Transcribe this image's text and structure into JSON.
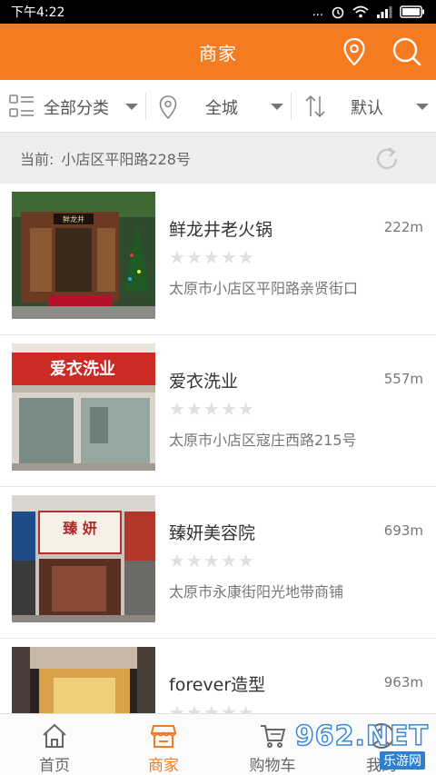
{
  "status_bar": {
    "time": "下午4:22",
    "dots": "...",
    "battery_icon": "battery-icon",
    "wifi_icon": "wifi-icon",
    "signal_icon": "signal-icon",
    "alarm_icon": "alarm-icon"
  },
  "header": {
    "title": "商家",
    "location_icon": "location-pin-icon",
    "search_icon": "search-icon",
    "color": "#f47b20"
  },
  "filters": [
    {
      "label": "全部分类",
      "icon": "grid-list-icon"
    },
    {
      "label": "全城",
      "icon": "location-pin-icon"
    },
    {
      "label": "默认",
      "icon": "sort-icon"
    }
  ],
  "location": {
    "prefix": "当前:",
    "address": "小店区平阳路228号",
    "refresh_icon": "refresh-icon"
  },
  "stores": [
    {
      "name": "鲜龙井老火锅",
      "distance": "222m",
      "address": "太原市小店区平阳路亲贤街口",
      "rating": 0,
      "sign_text": "鲜龙井"
    },
    {
      "name": "爱衣洗业",
      "distance": "557m",
      "address": "太原市小店区寇庄西路215号",
      "rating": 0,
      "sign_text": "爱衣洗业"
    },
    {
      "name": "臻妍美容院",
      "distance": "693m",
      "address": "太原市永康街阳光地带商铺",
      "rating": 0,
      "sign_text": "臻 妍"
    },
    {
      "name": "forever造型",
      "distance": "963m",
      "address": "",
      "rating": 0,
      "sign_text": ""
    }
  ],
  "bottom_nav": [
    {
      "label": "首页",
      "icon": "home-icon",
      "active": false
    },
    {
      "label": "商家",
      "icon": "store-icon",
      "active": true
    },
    {
      "label": "购物车",
      "icon": "cart-icon",
      "active": false
    },
    {
      "label": "我的",
      "icon": "user-icon",
      "active": false
    }
  ],
  "watermark": {
    "main": "962.NET",
    "sub": "乐游网"
  }
}
